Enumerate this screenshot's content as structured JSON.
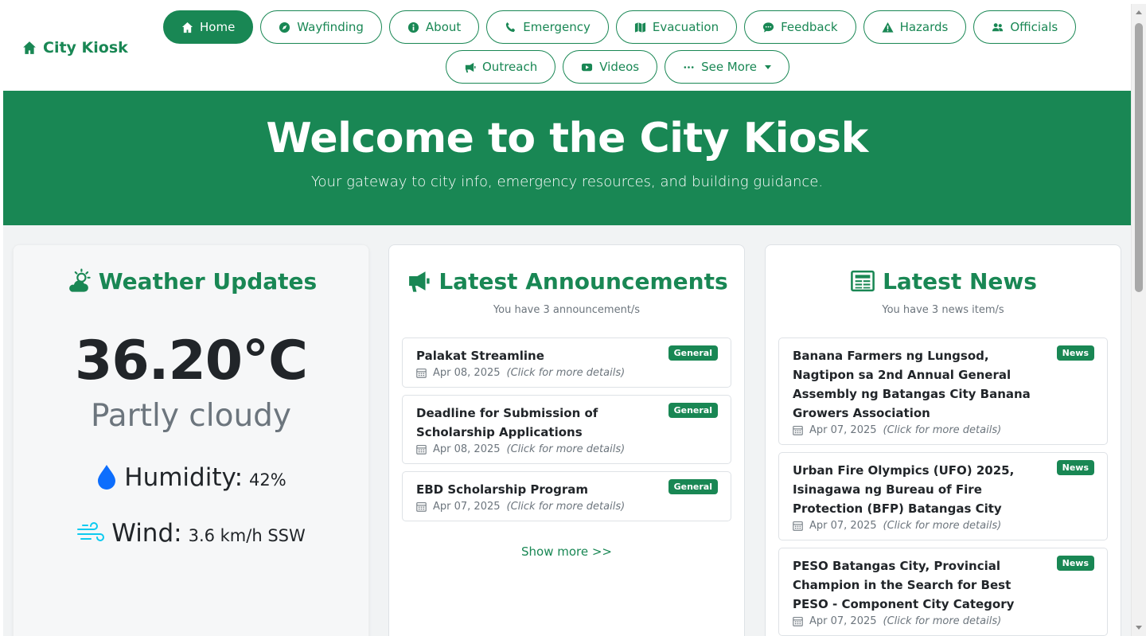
{
  "brand": {
    "name": "City Kiosk",
    "icon": "home-icon"
  },
  "nav": {
    "row1": [
      {
        "label": "Home",
        "icon": "home-icon",
        "active": true
      },
      {
        "label": "Wayfinding",
        "icon": "compass-icon"
      },
      {
        "label": "About",
        "icon": "info-icon"
      },
      {
        "label": "Emergency",
        "icon": "phone-icon"
      },
      {
        "label": "Evacuation",
        "icon": "map-icon"
      },
      {
        "label": "Feedback",
        "icon": "comment-icon"
      },
      {
        "label": "Hazards",
        "icon": "warning-icon"
      },
      {
        "label": "Officials",
        "icon": "users-icon"
      }
    ],
    "row2": [
      {
        "label": "Outreach",
        "icon": "megaphone-icon"
      },
      {
        "label": "Videos",
        "icon": "video-icon"
      },
      {
        "label": "See More",
        "icon": "ellipsis-icon"
      }
    ]
  },
  "hero": {
    "title": "Welcome to the City Kiosk",
    "subtitle": "Your gateway to city info, emergency resources, and building guidance."
  },
  "weather": {
    "title": "Weather Updates",
    "temperature": "36.20°C",
    "condition": "Partly cloudy",
    "humidity_label": "Humidity:",
    "humidity_value": "42%",
    "wind_label": "Wind:",
    "wind_value": "3.6 km/h SSW"
  },
  "announcements": {
    "title": "Latest Announcements",
    "count_text": "You have 3 announcement/s",
    "items": [
      {
        "title": "Palakat Streamline",
        "badge": "General",
        "date": "Apr 08, 2025",
        "note": "(Click for more details)"
      },
      {
        "title": "Deadline for Submission of Scholarship Applications",
        "badge": "General",
        "date": "Apr 08, 2025",
        "note": "(Click for more details)"
      },
      {
        "title": "EBD Scholarship Program",
        "badge": "General",
        "date": "Apr 07, 2025",
        "note": "(Click for more details)"
      }
    ],
    "show_more": "Show more >>"
  },
  "news": {
    "title": "Latest News",
    "count_text": "You have 3 news item/s",
    "items": [
      {
        "title": "Banana Farmers ng Lungsod, Nagtipon sa 2nd Annual General Assembly ng Batangas City Banana Growers Association",
        "badge": "News",
        "date": "Apr 07, 2025",
        "note": "(Click for more details)"
      },
      {
        "title": "Urban Fire Olympics (UFO) 2025, Isinagawa ng Bureau of Fire Protection (BFP) Batangas City",
        "badge": "News",
        "date": "Apr 07, 2025",
        "note": "(Click for more details)"
      },
      {
        "title": "PESO Batangas City, Provincial Champion in the Search for Best PESO - Component City Category",
        "badge": "News",
        "date": "Apr 07, 2025",
        "note": "(Click for more details)"
      }
    ]
  },
  "colors": {
    "primary": "#198754",
    "muted": "#6c757d",
    "text": "#212529",
    "humidity_icon": "#0d6efd",
    "wind_icon": "#0dcaf0"
  }
}
